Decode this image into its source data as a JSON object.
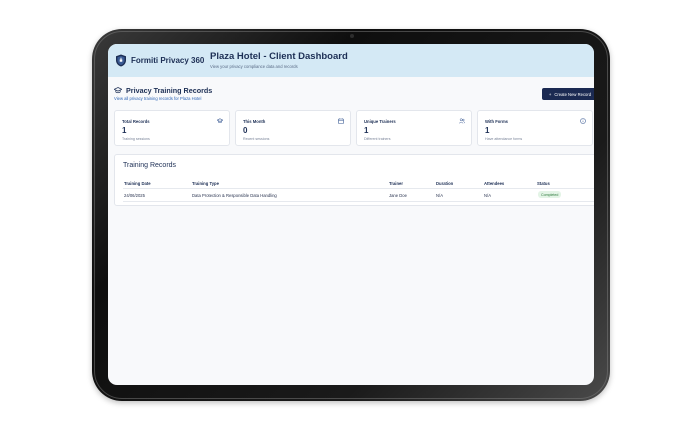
{
  "app": {
    "brand_name": "Formiti Privacy 360",
    "title": "Plaza Hotel - Client Dashboard",
    "subtitle": "View your privacy compliance data and records"
  },
  "section": {
    "title": "Privacy Training Records",
    "subtitle": "View all privacy training records for Plaza Hotel",
    "create_button": "Create New Record"
  },
  "stats": [
    {
      "label": "Total Records",
      "value": "1",
      "desc": "Training sessions",
      "icon": "graduation-cap-icon"
    },
    {
      "label": "This Month",
      "value": "0",
      "desc": "Recent sessions",
      "icon": "calendar-icon"
    },
    {
      "label": "Unique Trainers",
      "value": "1",
      "desc": "Different trainers",
      "icon": "users-icon"
    },
    {
      "label": "With Forms",
      "value": "1",
      "desc": "Have attendance forms",
      "icon": "info-icon"
    }
  ],
  "table": {
    "title": "Training Records",
    "columns": [
      "Training Date",
      "Training Type",
      "Trainer",
      "Duration",
      "Attendees",
      "Status"
    ],
    "rows": [
      {
        "date": "24/06/2025",
        "type": "Data Protection & Responsible Data Handling",
        "trainer": "Jane Doe",
        "duration": "N/A",
        "attendees": "N/A",
        "status": "Completed"
      }
    ]
  },
  "colors": {
    "header_bg": "#d4e9f5",
    "primary": "#1b2a52",
    "link": "#2b63b5",
    "status_completed_bg": "#e3f4e6",
    "status_completed_fg": "#2f7a3d"
  }
}
